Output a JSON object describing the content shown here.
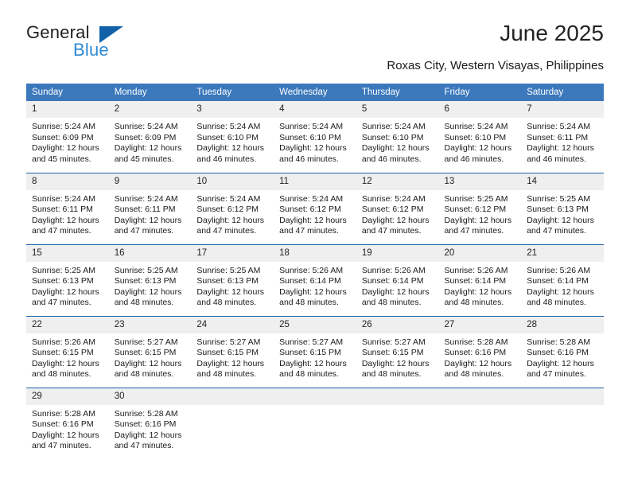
{
  "logo": {
    "primary_text": "General",
    "secondary_text": "Blue",
    "triangle_color": "#1061a8",
    "secondary_color": "#2e8ad4"
  },
  "header": {
    "title": "June 2025",
    "subtitle": "Roxas City, Western Visayas, Philippines"
  },
  "theme": {
    "header_blue": "#3b78bc",
    "separator_blue": "#1d5fa8",
    "daynum_gray": "#efefef"
  },
  "calendar": {
    "weekdays": [
      "Sunday",
      "Monday",
      "Tuesday",
      "Wednesday",
      "Thursday",
      "Friday",
      "Saturday"
    ],
    "labels": {
      "sunrise": "Sunrise:",
      "sunset": "Sunset:",
      "daylight": "Daylight:"
    },
    "weeks": [
      [
        {
          "day": "1",
          "sunrise": "Sunrise: 5:24 AM",
          "sunset": "Sunset: 6:09 PM",
          "daylight_line1": "Daylight: 12 hours",
          "daylight_line2": "and 45 minutes."
        },
        {
          "day": "2",
          "sunrise": "Sunrise: 5:24 AM",
          "sunset": "Sunset: 6:09 PM",
          "daylight_line1": "Daylight: 12 hours",
          "daylight_line2": "and 45 minutes."
        },
        {
          "day": "3",
          "sunrise": "Sunrise: 5:24 AM",
          "sunset": "Sunset: 6:10 PM",
          "daylight_line1": "Daylight: 12 hours",
          "daylight_line2": "and 46 minutes."
        },
        {
          "day": "4",
          "sunrise": "Sunrise: 5:24 AM",
          "sunset": "Sunset: 6:10 PM",
          "daylight_line1": "Daylight: 12 hours",
          "daylight_line2": "and 46 minutes."
        },
        {
          "day": "5",
          "sunrise": "Sunrise: 5:24 AM",
          "sunset": "Sunset: 6:10 PM",
          "daylight_line1": "Daylight: 12 hours",
          "daylight_line2": "and 46 minutes."
        },
        {
          "day": "6",
          "sunrise": "Sunrise: 5:24 AM",
          "sunset": "Sunset: 6:10 PM",
          "daylight_line1": "Daylight: 12 hours",
          "daylight_line2": "and 46 minutes."
        },
        {
          "day": "7",
          "sunrise": "Sunrise: 5:24 AM",
          "sunset": "Sunset: 6:11 PM",
          "daylight_line1": "Daylight: 12 hours",
          "daylight_line2": "and 46 minutes."
        }
      ],
      [
        {
          "day": "8",
          "sunrise": "Sunrise: 5:24 AM",
          "sunset": "Sunset: 6:11 PM",
          "daylight_line1": "Daylight: 12 hours",
          "daylight_line2": "and 47 minutes."
        },
        {
          "day": "9",
          "sunrise": "Sunrise: 5:24 AM",
          "sunset": "Sunset: 6:11 PM",
          "daylight_line1": "Daylight: 12 hours",
          "daylight_line2": "and 47 minutes."
        },
        {
          "day": "10",
          "sunrise": "Sunrise: 5:24 AM",
          "sunset": "Sunset: 6:12 PM",
          "daylight_line1": "Daylight: 12 hours",
          "daylight_line2": "and 47 minutes."
        },
        {
          "day": "11",
          "sunrise": "Sunrise: 5:24 AM",
          "sunset": "Sunset: 6:12 PM",
          "daylight_line1": "Daylight: 12 hours",
          "daylight_line2": "and 47 minutes."
        },
        {
          "day": "12",
          "sunrise": "Sunrise: 5:24 AM",
          "sunset": "Sunset: 6:12 PM",
          "daylight_line1": "Daylight: 12 hours",
          "daylight_line2": "and 47 minutes."
        },
        {
          "day": "13",
          "sunrise": "Sunrise: 5:25 AM",
          "sunset": "Sunset: 6:12 PM",
          "daylight_line1": "Daylight: 12 hours",
          "daylight_line2": "and 47 minutes."
        },
        {
          "day": "14",
          "sunrise": "Sunrise: 5:25 AM",
          "sunset": "Sunset: 6:13 PM",
          "daylight_line1": "Daylight: 12 hours",
          "daylight_line2": "and 47 minutes."
        }
      ],
      [
        {
          "day": "15",
          "sunrise": "Sunrise: 5:25 AM",
          "sunset": "Sunset: 6:13 PM",
          "daylight_line1": "Daylight: 12 hours",
          "daylight_line2": "and 47 minutes."
        },
        {
          "day": "16",
          "sunrise": "Sunrise: 5:25 AM",
          "sunset": "Sunset: 6:13 PM",
          "daylight_line1": "Daylight: 12 hours",
          "daylight_line2": "and 48 minutes."
        },
        {
          "day": "17",
          "sunrise": "Sunrise: 5:25 AM",
          "sunset": "Sunset: 6:13 PM",
          "daylight_line1": "Daylight: 12 hours",
          "daylight_line2": "and 48 minutes."
        },
        {
          "day": "18",
          "sunrise": "Sunrise: 5:26 AM",
          "sunset": "Sunset: 6:14 PM",
          "daylight_line1": "Daylight: 12 hours",
          "daylight_line2": "and 48 minutes."
        },
        {
          "day": "19",
          "sunrise": "Sunrise: 5:26 AM",
          "sunset": "Sunset: 6:14 PM",
          "daylight_line1": "Daylight: 12 hours",
          "daylight_line2": "and 48 minutes."
        },
        {
          "day": "20",
          "sunrise": "Sunrise: 5:26 AM",
          "sunset": "Sunset: 6:14 PM",
          "daylight_line1": "Daylight: 12 hours",
          "daylight_line2": "and 48 minutes."
        },
        {
          "day": "21",
          "sunrise": "Sunrise: 5:26 AM",
          "sunset": "Sunset: 6:14 PM",
          "daylight_line1": "Daylight: 12 hours",
          "daylight_line2": "and 48 minutes."
        }
      ],
      [
        {
          "day": "22",
          "sunrise": "Sunrise: 5:26 AM",
          "sunset": "Sunset: 6:15 PM",
          "daylight_line1": "Daylight: 12 hours",
          "daylight_line2": "and 48 minutes."
        },
        {
          "day": "23",
          "sunrise": "Sunrise: 5:27 AM",
          "sunset": "Sunset: 6:15 PM",
          "daylight_line1": "Daylight: 12 hours",
          "daylight_line2": "and 48 minutes."
        },
        {
          "day": "24",
          "sunrise": "Sunrise: 5:27 AM",
          "sunset": "Sunset: 6:15 PM",
          "daylight_line1": "Daylight: 12 hours",
          "daylight_line2": "and 48 minutes."
        },
        {
          "day": "25",
          "sunrise": "Sunrise: 5:27 AM",
          "sunset": "Sunset: 6:15 PM",
          "daylight_line1": "Daylight: 12 hours",
          "daylight_line2": "and 48 minutes."
        },
        {
          "day": "26",
          "sunrise": "Sunrise: 5:27 AM",
          "sunset": "Sunset: 6:15 PM",
          "daylight_line1": "Daylight: 12 hours",
          "daylight_line2": "and 48 minutes."
        },
        {
          "day": "27",
          "sunrise": "Sunrise: 5:28 AM",
          "sunset": "Sunset: 6:16 PM",
          "daylight_line1": "Daylight: 12 hours",
          "daylight_line2": "and 48 minutes."
        },
        {
          "day": "28",
          "sunrise": "Sunrise: 5:28 AM",
          "sunset": "Sunset: 6:16 PM",
          "daylight_line1": "Daylight: 12 hours",
          "daylight_line2": "and 47 minutes."
        }
      ],
      [
        {
          "day": "29",
          "sunrise": "Sunrise: 5:28 AM",
          "sunset": "Sunset: 6:16 PM",
          "daylight_line1": "Daylight: 12 hours",
          "daylight_line2": "and 47 minutes."
        },
        {
          "day": "30",
          "sunrise": "Sunrise: 5:28 AM",
          "sunset": "Sunset: 6:16 PM",
          "daylight_line1": "Daylight: 12 hours",
          "daylight_line2": "and 47 minutes."
        },
        {
          "day": "",
          "sunrise": "",
          "sunset": "",
          "daylight_line1": "",
          "daylight_line2": ""
        },
        {
          "day": "",
          "sunrise": "",
          "sunset": "",
          "daylight_line1": "",
          "daylight_line2": ""
        },
        {
          "day": "",
          "sunrise": "",
          "sunset": "",
          "daylight_line1": "",
          "daylight_line2": ""
        },
        {
          "day": "",
          "sunrise": "",
          "sunset": "",
          "daylight_line1": "",
          "daylight_line2": ""
        },
        {
          "day": "",
          "sunrise": "",
          "sunset": "",
          "daylight_line1": "",
          "daylight_line2": ""
        }
      ]
    ]
  }
}
